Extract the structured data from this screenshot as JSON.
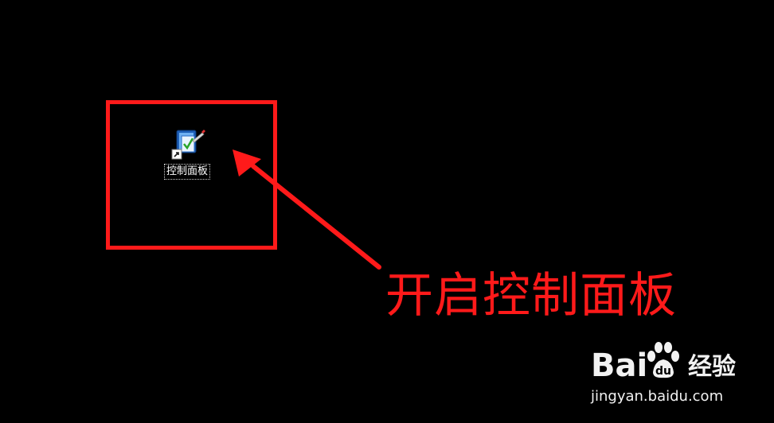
{
  "desktop": {
    "background_color": "#000000",
    "shortcut": {
      "icon": "control-panel-icon",
      "overlay_icon": "shortcut-arrow-icon",
      "label": "控制面板"
    }
  },
  "annotation": {
    "highlight_color": "#ff1a1a",
    "caption": "开启控制面板"
  },
  "watermark": {
    "brand": "Bai",
    "brand_suffix": "经验",
    "url": "jingyan.baidu.com",
    "color": "#f2f2f2"
  }
}
